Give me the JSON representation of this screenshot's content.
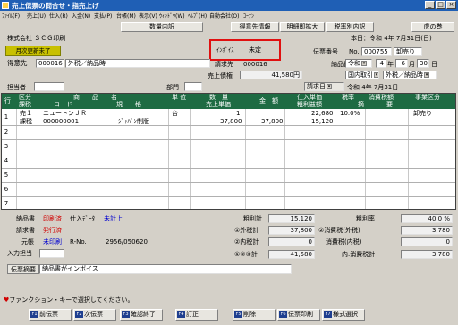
{
  "window": {
    "title": "売上伝票の問合せ・指売上げ",
    "buttons": [
      "_",
      "□",
      "×"
    ]
  },
  "menu": [
    "ﾌｧｲﾙ(F)",
    "売上(U)",
    "仕入(R)",
    "入金(N)",
    "支払(P)",
    "台帳(M)",
    "表示(V)",
    "ｳｨﾝﾄﾞｳ(W)",
    "ﾍﾙﾌﾟ(H)",
    "自動会社(O)",
    "ｺｰﾅﾝ"
  ],
  "toolbar": {
    "btn1": "数量内訳",
    "btn2": "得意先情報",
    "btn3": "明細即拡大",
    "btn4": "税率別内訳",
    "btn5": "虎の巻"
  },
  "company": "株式会社 ＳＣＧ印刷",
  "today": "本日：令和 4年 7月31日(日)",
  "monthly_status": "月次更新未了",
  "invoice": {
    "label": "ｲﾝﾎﾞｲｽ",
    "value": "未定"
  },
  "slip": {
    "label": "伝票番号",
    "label2": "No.",
    "number": "000755",
    "type": "卸売り"
  },
  "customer": {
    "label": "得意先",
    "code": "000016",
    "name": "外税／納品時"
  },
  "billing": {
    "label": "請求先",
    "code": "000016"
  },
  "delivery": {
    "label": "納品日",
    "era": "令和",
    "year": "4",
    "y_unit": "年",
    "month": "6",
    "m_unit": "月",
    "day": "30",
    "d_unit": "日"
  },
  "balance": {
    "label": "売上債権",
    "value": "41,580円"
  },
  "domestic": "国内取引",
  "tax_mode": "外税／納品時",
  "staff": {
    "label": "担当者",
    "dept": "部門"
  },
  "bill_date": {
    "label": "請求日",
    "value": "令和 4年 7月31日"
  },
  "grid": {
    "headers": {
      "row": "行",
      "kubun": "区分",
      "kubun2": "課税",
      "shohin": "商　　品　　名",
      "code": "コード",
      "kikaku": "規　　格",
      "tani": "単 位",
      "suryo": "数　量",
      "tanka": "売上単価",
      "kingaku": "金　額",
      "shiire": "仕入単価",
      "arari": "粗利益額",
      "zeiritsu": "税率",
      "tekiyo1": "摘",
      "tekiyo2": "要",
      "shohizei": "消費税額",
      "jigyo": "事業区分"
    },
    "rows": [
      {
        "no": "1",
        "kubun": "売１",
        "kazei": "課税",
        "name": "ニュートンＪＲ",
        "code": "000000001",
        "kikaku": "ｼﾞｬﾊﾟﾝ制版",
        "tani": "台",
        "qty": "1",
        "price": "37,800",
        "amount": "37,800",
        "cost": "22,680",
        "arari": "15,120",
        "rate": "10.0%",
        "jigyo": "卸売り"
      },
      {
        "no": "2"
      },
      {
        "no": "3"
      },
      {
        "no": "4"
      },
      {
        "no": "5"
      },
      {
        "no": "6"
      },
      {
        "no": "7"
      }
    ]
  },
  "footer": {
    "nohin_label": "納品書",
    "nohin_val": "印刷済",
    "shire_data": "仕入ﾃﾞｰﾀ",
    "shire_val": "未計上",
    "seikyu_label": "請求書",
    "seikyu_val": "発行済",
    "moto_label": "元帳",
    "moto_val": "未印刷",
    "rno_label": "R-No.",
    "rno_val": "2956/050620",
    "input_staff": "入力担当",
    "arari_label": "粗利計",
    "arari_val": "15,120",
    "arari_rate_label": "粗利率",
    "arari_rate_val": "40.0 %",
    "gaizei_label": "①外税計",
    "gaizei_val": "37,800",
    "shohizei_label": "②消費税(外税)",
    "shohizei_val": "3,780",
    "naizei_label": "②内税計",
    "naizei_val": "0",
    "shohizei_nai_label": "消費税(内税)",
    "shohizei_nai_val": "0",
    "total_label": "①②③計",
    "total_val": "41,580",
    "uchi_label": "内.消費税計",
    "uchi_val": "3,780",
    "memo_label": "伝票摘要",
    "memo_val": "納品書がインボイス",
    "hint": "ファンクション・キーで選択してください。"
  },
  "fkeys": [
    {
      "key": "F1",
      "label": "前伝票"
    },
    {
      "key": "F2",
      "label": "次伝票"
    },
    {
      "key": "F3",
      "label": "確認終了"
    },
    {
      "key": "F4",
      "label": "訂正"
    },
    {
      "key": "F5",
      "label": "削除"
    },
    {
      "key": "F6",
      "label": "伝票印刷"
    },
    {
      "key": "F7",
      "label": "様式選択"
    }
  ]
}
